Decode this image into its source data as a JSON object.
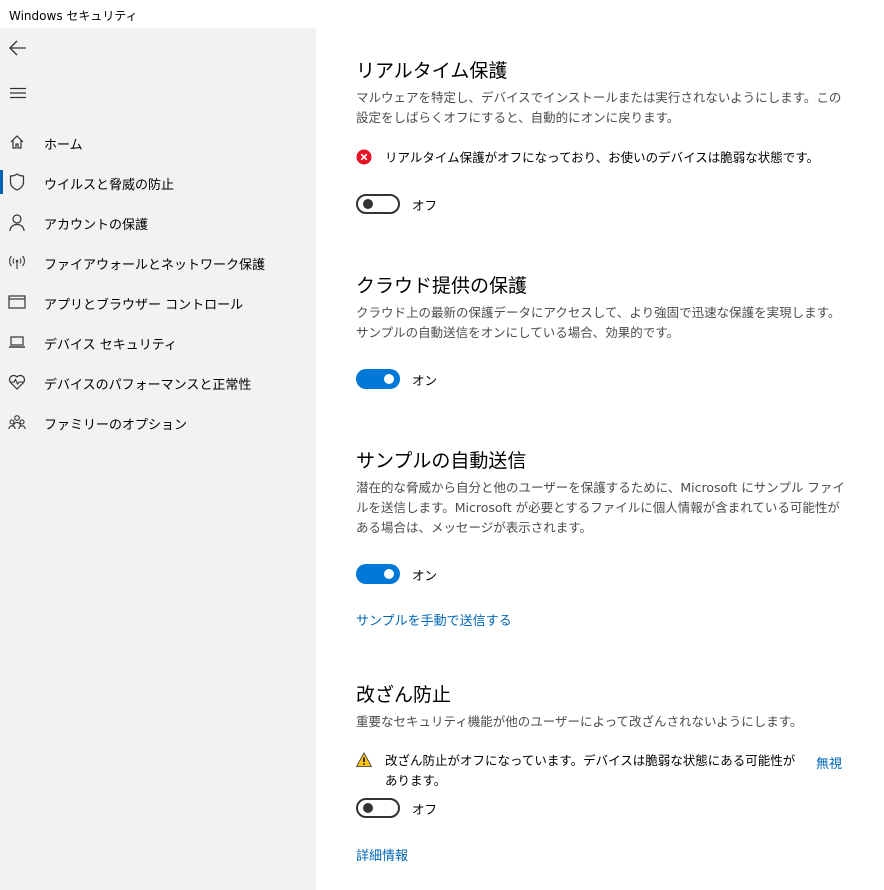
{
  "window": {
    "title": "Windows セキュリティ"
  },
  "sidebar": {
    "items": [
      {
        "label": "ホーム",
        "icon": "home-icon"
      },
      {
        "label": "ウイルスと脅威の防止",
        "icon": "shield-icon",
        "active": true
      },
      {
        "label": "アカウントの保護",
        "icon": "person-icon"
      },
      {
        "label": "ファイアウォールとネットワーク保護",
        "icon": "wifi-antenna-icon"
      },
      {
        "label": "アプリとブラウザー コントロール",
        "icon": "app-window-icon"
      },
      {
        "label": "デバイス セキュリティ",
        "icon": "laptop-icon"
      },
      {
        "label": "デバイスのパフォーマンスと正常性",
        "icon": "heart-pulse-icon"
      },
      {
        "label": "ファミリーのオプション",
        "icon": "family-icon"
      }
    ]
  },
  "realtime": {
    "title": "リアルタイム保護",
    "desc": "マルウェアを特定し、デバイスでインストールまたは実行されないようにします。この設定をしばらくオフにすると、自動的にオンに戻ります。",
    "alert": "リアルタイム保護がオフになっており、お使いのデバイスは脆弱な状態です。",
    "toggle_state": "off",
    "toggle_label": "オフ"
  },
  "cloud": {
    "title": "クラウド提供の保護",
    "desc": "クラウド上の最新の保護データにアクセスして、より強固で迅速な保護を実現します。サンプルの自動送信をオンにしている場合、効果的です。",
    "toggle_state": "on",
    "toggle_label": "オン"
  },
  "sample": {
    "title": "サンプルの自動送信",
    "desc": "潜在的な脅威から自分と他のユーザーを保護するために、Microsoft にサンプル ファイルを送信します。Microsoft が必要とするファイルに個人情報が含まれている可能性がある場合は、メッセージが表示されます。",
    "toggle_state": "on",
    "toggle_label": "オン",
    "manual_link": "サンプルを手動で送信する"
  },
  "tamper": {
    "title": "改ざん防止",
    "desc": "重要なセキュリティ機能が他のユーザーによって改ざんされないようにします。",
    "alert": "改ざん防止がオフになっています。デバイスは脆弱な状態にある可能性があります。",
    "dismiss_link": "無視",
    "toggle_state": "off",
    "toggle_label": "オフ",
    "more_link": "詳細情報"
  },
  "colors": {
    "accent": "#0078d7",
    "link": "#0067b8",
    "error": "#e81123",
    "warning": "#fcc419"
  }
}
